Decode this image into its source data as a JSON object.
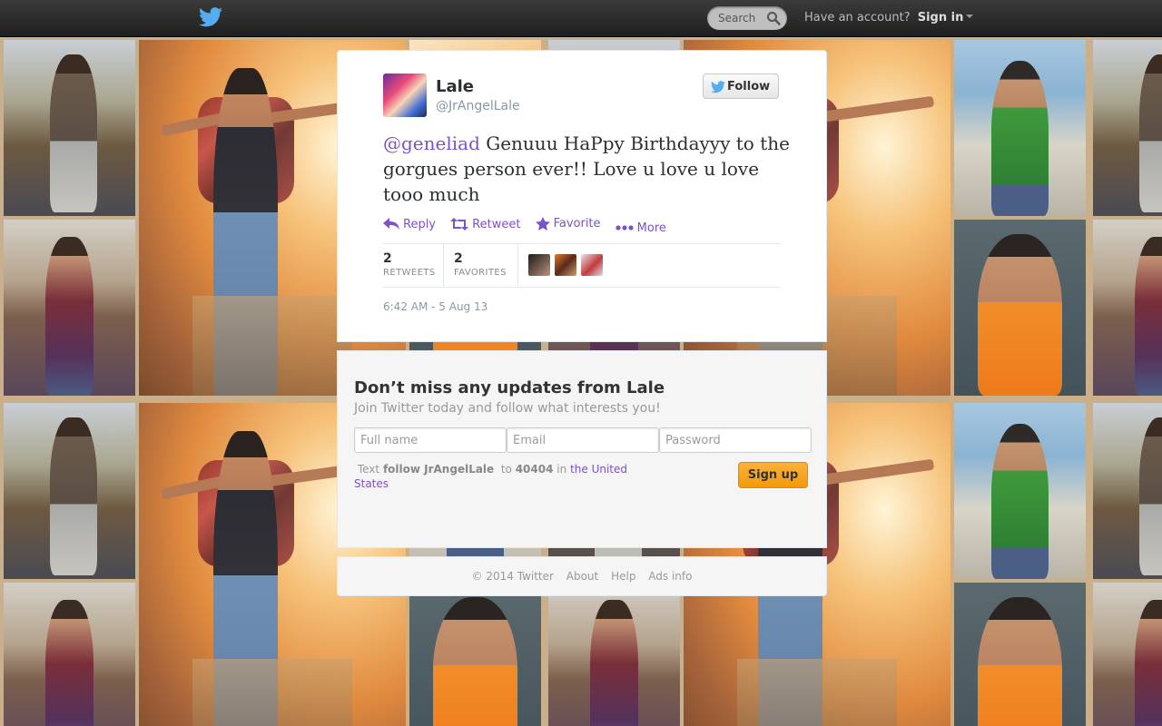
{
  "topbar": {
    "search_placeholder": "Search",
    "have_account": "Have an account?",
    "sign_in": "Sign in"
  },
  "tweet": {
    "author_name": "Lale",
    "author_handle": "@JrAngelLale",
    "follow_label": "Follow",
    "mention": "@geneliad",
    "text": " Genuuu HaPpy Birthdayyy to the gorgues person ever!! Love u love u love tooo much",
    "actions": {
      "reply": "Reply",
      "retweet": "Retweet",
      "favorite": "Favorite",
      "more": "More"
    },
    "stats": {
      "retweets": "2",
      "retweets_label": "RETWEETS",
      "favorites": "2",
      "favorites_label": "FAVORITES"
    },
    "timestamp": "6:42 AM - 5 Aug 13"
  },
  "signup": {
    "title": "Don’t miss any updates from Lale",
    "subtitle": "Join Twitter today and follow what interests you!",
    "fullname_placeholder": "Full name",
    "email_placeholder": "Email",
    "password_placeholder": "Password",
    "sms_text": "Text",
    "sms_command": "follow JrAngelLale",
    "sms_to": "to",
    "sms_number": "40404",
    "sms_in": "in",
    "sms_country": "the United States",
    "signup_label": "Sign up"
  },
  "footer": {
    "copyright": "© 2014 Twitter",
    "about": "About",
    "help": "Help",
    "ads_info": "Ads info"
  },
  "colors": {
    "link": "#7b52c8",
    "twitter_blue": "#55acee",
    "signup_orange": "#f29a09"
  },
  "icons": [
    "twitter-bird-icon",
    "search-icon",
    "reply-icon",
    "retweet-icon",
    "star-icon",
    "more-dots-icon"
  ]
}
